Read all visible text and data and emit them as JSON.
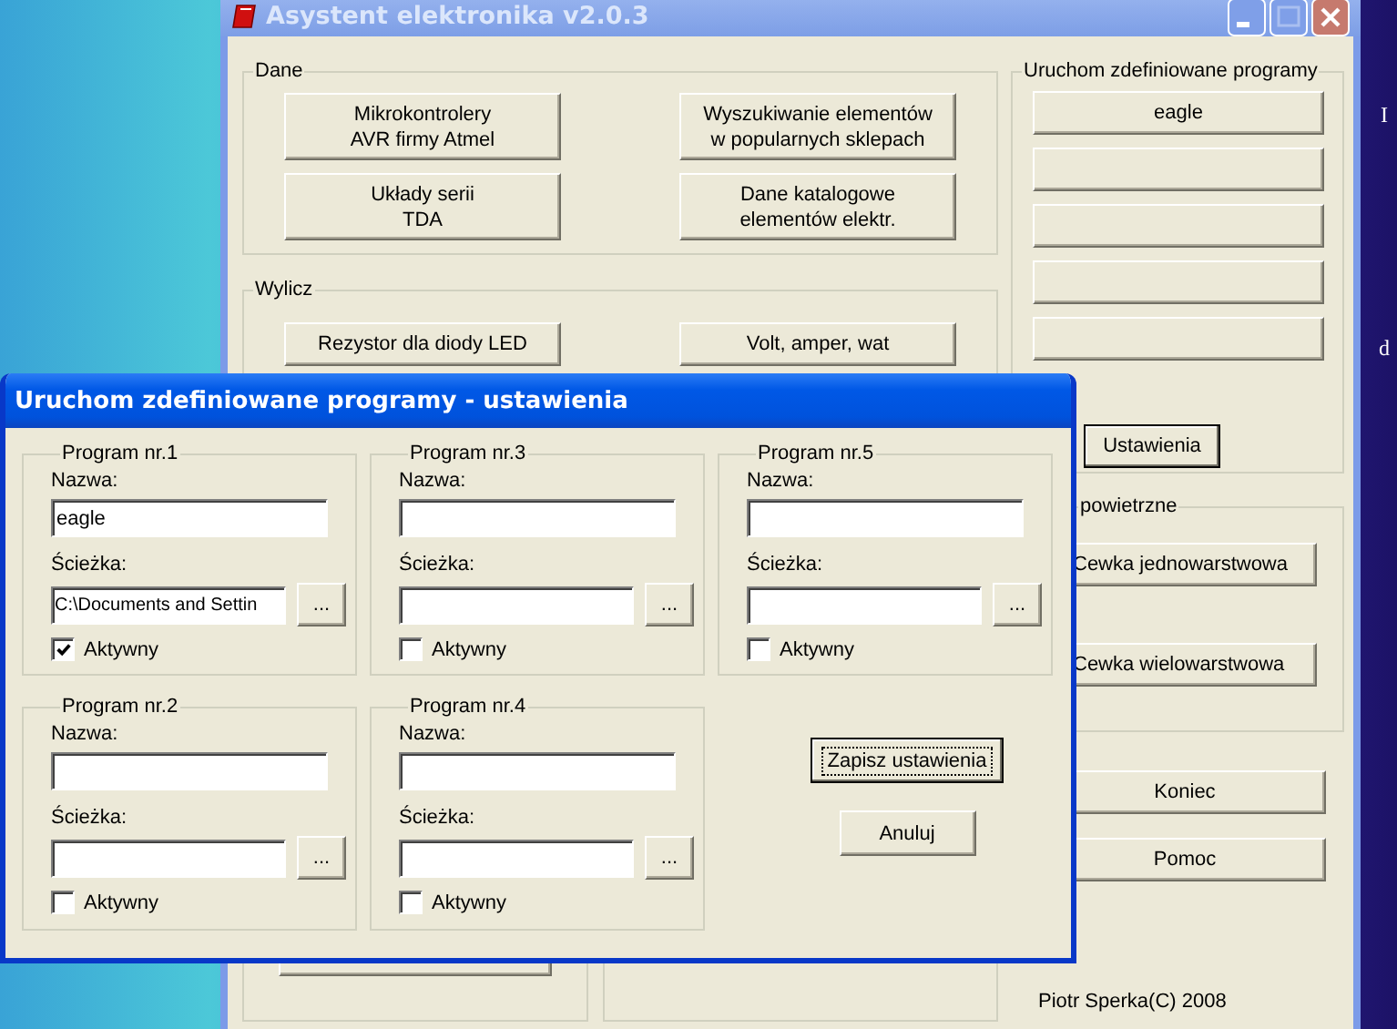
{
  "desktop": {
    "label_fragments": [
      "I",
      "d"
    ]
  },
  "main_window": {
    "title": "Asystent elektronika v2.0.3",
    "dane": {
      "title": "Dane",
      "buttons": [
        {
          "lines": [
            "Mikrokontrolery",
            "AVR firmy Atmel"
          ]
        },
        {
          "lines": [
            "Wyszukiwanie elementów",
            "w popularnych sklepach"
          ]
        },
        {
          "lines": [
            "Układy serii",
            "TDA"
          ]
        },
        {
          "lines": [
            "Dane katalogowe",
            "elementów elektr."
          ]
        }
      ]
    },
    "wylicz": {
      "title": "Wylicz",
      "buttons": [
        "Rezystor dla diody LED",
        "Volt, amper, wat"
      ]
    },
    "programs": {
      "title": "Uruchom zdefiniowane programy",
      "buttons": [
        {
          "kind": "named",
          "label": "eagle"
        },
        {
          "kind": "blank"
        },
        {
          "kind": "blank"
        },
        {
          "kind": "blank"
        },
        {
          "kind": "blank"
        }
      ],
      "settings_button": {
        "label": "Ustawienia",
        "focused": true
      }
    },
    "coils": {
      "title": "powietrzne",
      "buttons": [
        "Cewka jednowarstwowa",
        "Cewka wielowarstwowa"
      ]
    },
    "actions": [
      "Koniec",
      "Pomoc"
    ],
    "footer": "Piotr Sperka(C) 2008"
  },
  "dialog": {
    "title": "Uruchom zdefiniowane programy - ustawienia",
    "programs": [
      {
        "title": "Program nr.1",
        "name_label": "Nazwa:",
        "name": "eagle",
        "path_label": "Ścieżka:",
        "path": "C:\\Documents and Settin",
        "browse": "...",
        "active_label": "Aktywny",
        "checked": true
      },
      {
        "title": "Program nr.2",
        "name_label": "Nazwa:",
        "path_label": "Ścieżka:",
        "browse": "...",
        "active_label": "Aktywny",
        "checked": false
      },
      {
        "title": "Program nr.3",
        "name_label": "Nazwa:",
        "path_label": "Ścieżka:",
        "browse": "...",
        "active_label": "Aktywny",
        "checked": false
      },
      {
        "title": "Program nr.4",
        "name_label": "Nazwa:",
        "path_label": "Ścieżka:",
        "browse": "...",
        "active_label": "Aktywny",
        "checked": false
      },
      {
        "title": "Program nr.5",
        "name_label": "Nazwa:",
        "path_label": "Ścieżka:",
        "browse": "...",
        "active_label": "Aktywny",
        "checked": false
      }
    ],
    "buttons": [
      {
        "label": "Zapisz ustawienia",
        "focused": true
      },
      {
        "label": "Anuluj",
        "focused": false
      }
    ]
  }
}
